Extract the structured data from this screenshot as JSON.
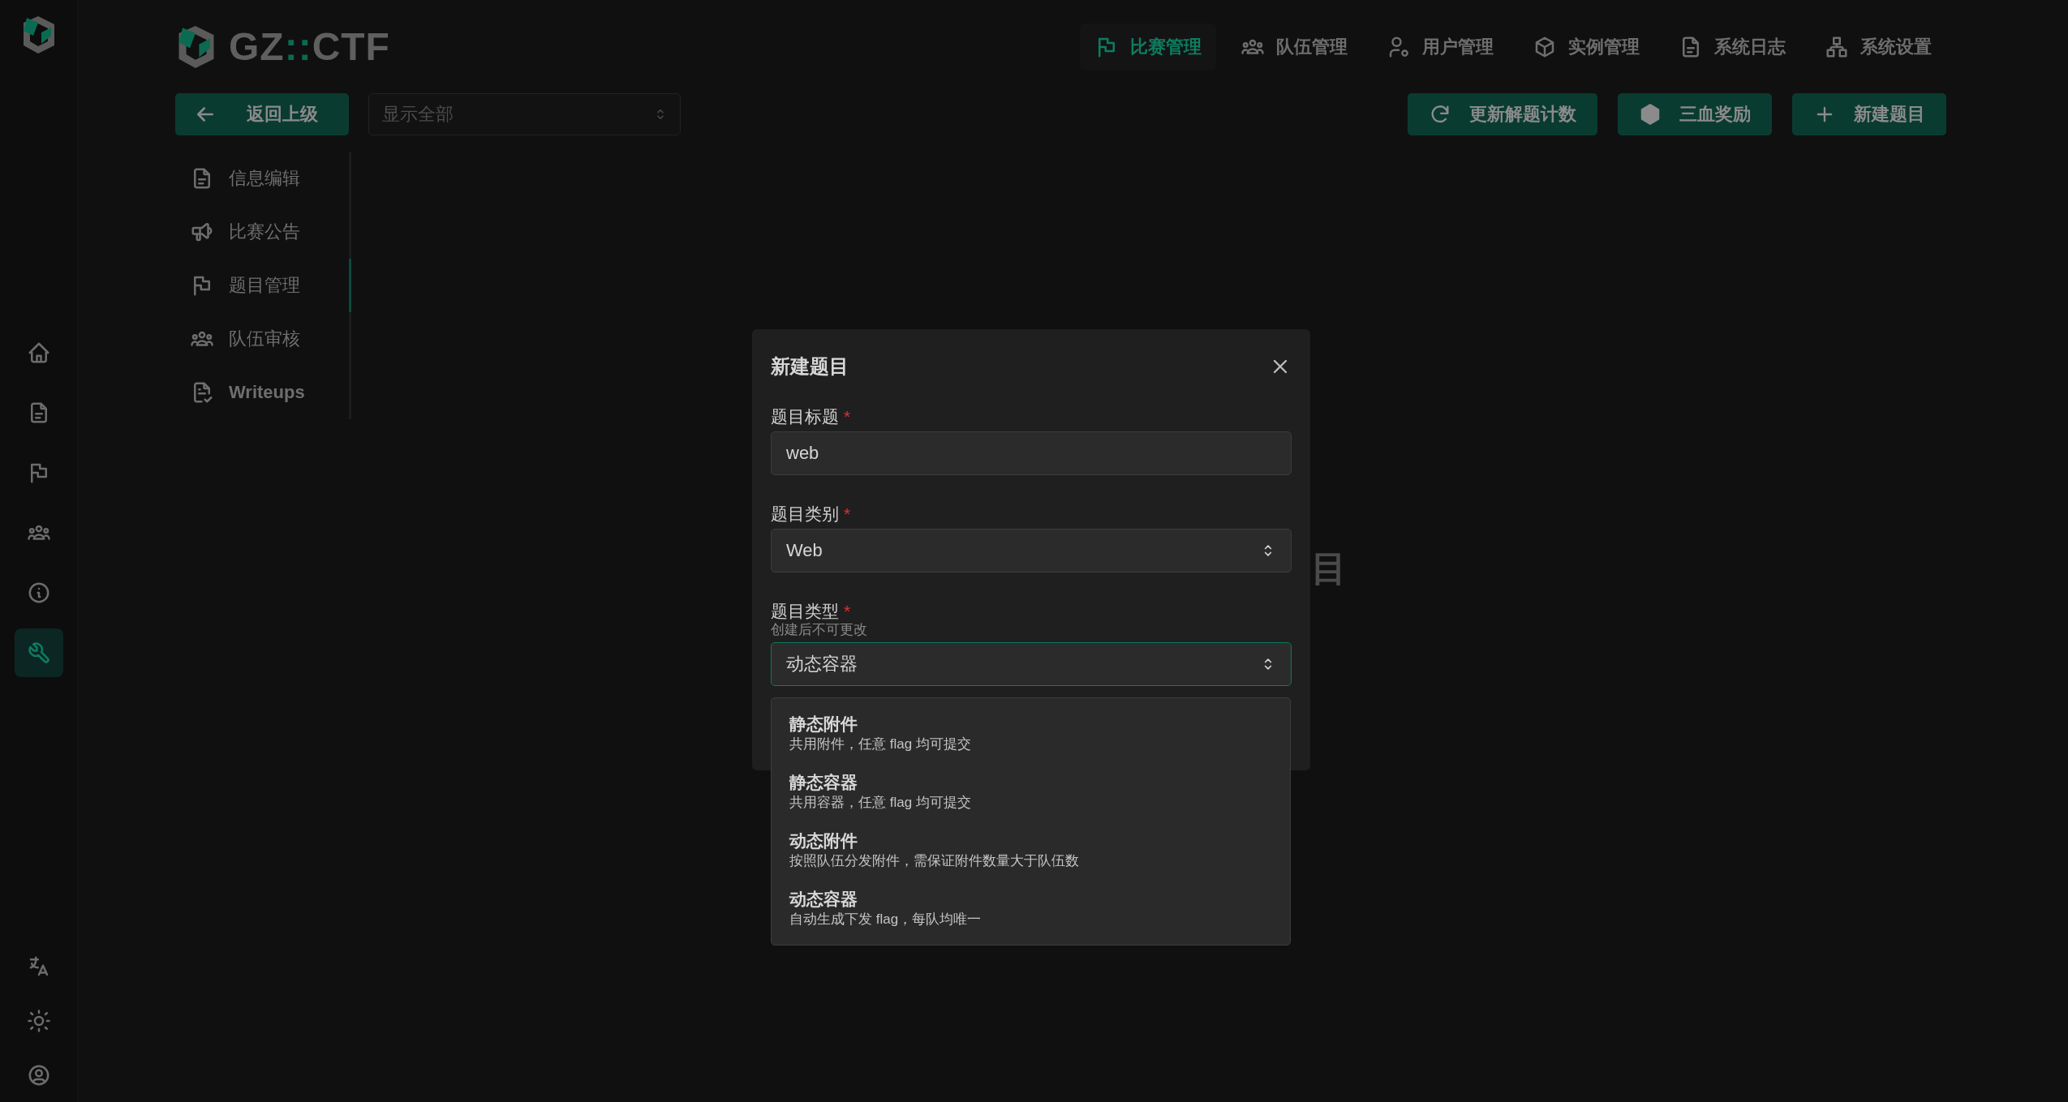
{
  "rail": {
    "items": [
      {
        "selected": false
      },
      {
        "selected": false
      },
      {
        "selected": false
      },
      {
        "selected": false
      },
      {
        "selected": false
      },
      {
        "selected": true
      }
    ]
  },
  "logo": {
    "parts": [
      {
        "text": "GZ",
        "accent": false
      },
      {
        "text": "::",
        "accent": true
      },
      {
        "text": "CTF",
        "accent": false
      }
    ]
  },
  "nav": [
    {
      "label": "比赛管理",
      "selected": true
    },
    {
      "label": "队伍管理",
      "selected": false
    },
    {
      "label": "用户管理",
      "selected": false
    },
    {
      "label": "实例管理",
      "selected": false
    },
    {
      "label": "系统日志",
      "selected": false
    },
    {
      "label": "系统设置",
      "selected": false
    }
  ],
  "toolbar": {
    "back_button": "返回上级",
    "filter": {
      "placeholder": "显示全部"
    },
    "actions": [
      "更新解题计数",
      "三血奖励",
      "新建题目"
    ]
  },
  "submenu": [
    {
      "label": "信息编辑",
      "selected": false
    },
    {
      "label": "比赛公告",
      "selected": false
    },
    {
      "label": "题目管理",
      "selected": true
    },
    {
      "label": "队伍审核",
      "selected": false
    },
    {
      "label": "Writeups",
      "selected": false
    }
  ],
  "empty_text": "目",
  "modal": {
    "title": "新建题目",
    "fields": [
      {
        "kind": "text",
        "label": "题目标题",
        "marker": "*",
        "value": "web",
        "focused": false
      },
      {
        "kind": "select",
        "label": "题目类别",
        "marker": "*",
        "value": "Web",
        "focused": false
      },
      {
        "kind": "select",
        "label": "题目类型",
        "marker": "*",
        "description": "创建后不可更改",
        "value": "动态容器",
        "focused": true
      }
    ]
  },
  "dropdown": {
    "options": [
      {
        "title": "静态附件",
        "description": "共用附件，任意 flag 均可提交"
      },
      {
        "title": "静态容器",
        "description": "共用容器，任意 flag 均可提交"
      },
      {
        "title": "动态附件",
        "description": "按照队伍分发附件，需保证附件数量大于队伍数"
      },
      {
        "title": "动态容器",
        "description": "自动生成下发 flag，每队均唯一"
      }
    ]
  }
}
